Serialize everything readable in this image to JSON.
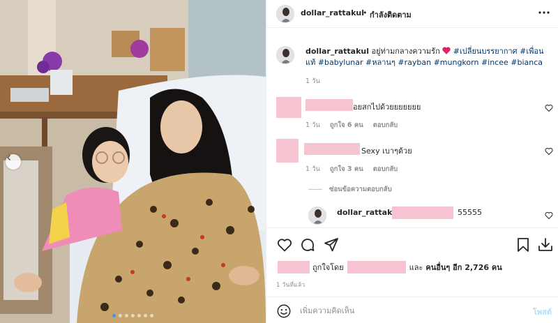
{
  "header": {
    "username": "dollar_rattakul",
    "separator": "•",
    "follow_label": "กำลังติดตาม",
    "more_icon": "more-horizontal-icon"
  },
  "caption": {
    "username": "dollar_rattakul",
    "text": "อยู่ท่ามกลางความรัก",
    "heart_emoji": "heart-emoji",
    "hashtags": [
      "#เปลี่ยนบรรยากาศ",
      "#เพื่อนแท้",
      "#babylunar",
      "#หลานๆ",
      "#rayban",
      "#mungkorn",
      "#incee",
      "#bianca"
    ],
    "time": "1 วัน"
  },
  "comments": [
    {
      "text": "อยสกไปด้วยยยยยยย",
      "time": "1 วัน",
      "likes": "ถูกใจ 6 คน",
      "reply_label": "ตอบกลับ"
    },
    {
      "text": "Sexy เบาๆด้วย",
      "time": "1 วัน",
      "likes": "ถูกใจ 3 คน",
      "reply_label": "ตอบกลับ"
    }
  ],
  "hide_replies_label": "ซ่อนข้อความตอบกลับ",
  "reply": {
    "username": "dollar_rattakul",
    "text": "55555"
  },
  "likes_line": {
    "liked_by": "ถูกใจโดย",
    "and_label": "และ",
    "others": "คนอื่นๆ อีก 2,726 คน"
  },
  "posted_time": "1 วันที่แล้ว",
  "composer": {
    "placeholder": "เพิ่มความคิดเห็น",
    "post_label": "โพสต์"
  },
  "colors": {
    "hashtag": "#00376b",
    "redaction": "#f6c4d0",
    "post_button_disabled": "#b2dffc",
    "muted_text": "#8e8e8e"
  }
}
